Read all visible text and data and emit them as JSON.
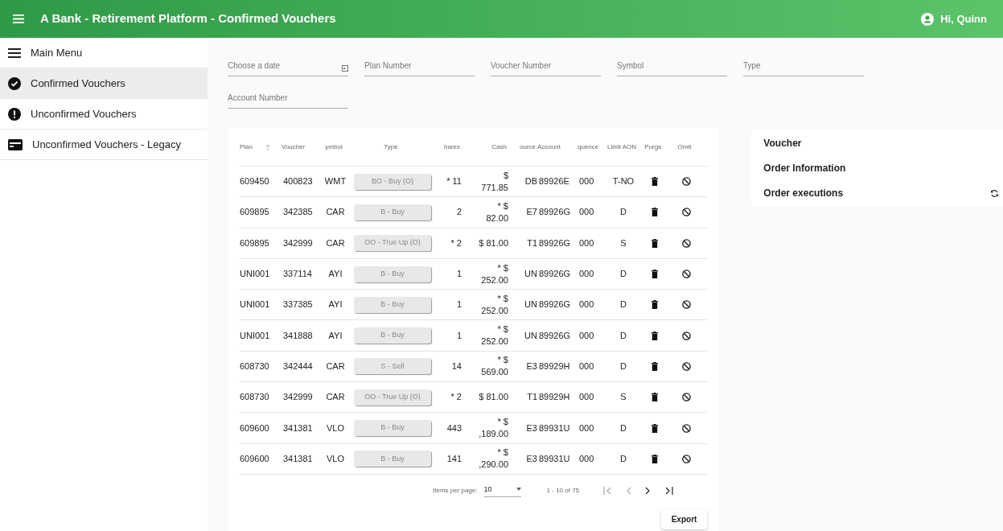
{
  "app_bar": {
    "title": "A Bank - Retirement Platform - Confirmed Vouchers",
    "user": "Hi, Quinn"
  },
  "sidebar": {
    "items": [
      {
        "label": "Main Menu",
        "kind": "menu",
        "selected": false
      },
      {
        "label": "Confirmed Vouchers",
        "kind": "check",
        "selected": true
      },
      {
        "label": "Unconfirmed Vouchers",
        "kind": "alert",
        "selected": false
      },
      {
        "label": "Unconfirmed Vouchers - Legacy",
        "kind": "card",
        "selected": false
      }
    ]
  },
  "filters": [
    {
      "placeholder": "Choose a date",
      "kind": "date"
    },
    {
      "placeholder": "Plan Number",
      "kind": "text"
    },
    {
      "placeholder": "Voucher Number",
      "kind": "text"
    },
    {
      "placeholder": "Symbol",
      "kind": "text"
    },
    {
      "placeholder": "Type",
      "kind": "text"
    },
    {
      "placeholder": "Account Number",
      "kind": "text"
    }
  ],
  "table": {
    "columns": [
      "Plan",
      "Voucher",
      "ymbol",
      "Type",
      "hares",
      "Cash",
      "ource",
      "Account",
      "quence",
      "Limit AON",
      "Purge",
      "Omit"
    ],
    "rows": [
      {
        "plan": "609450",
        "voucher": "400823",
        "symbol": "WMT",
        "type": "BO - Buy (O)",
        "shares": "* 11",
        "cash": "$\n771.85",
        "source": "DB",
        "account": "89926E",
        "sequence": "000",
        "limit": "T-NO"
      },
      {
        "plan": "609895",
        "voucher": "342385",
        "symbol": "CAR",
        "type": "B - Buy",
        "shares": "2",
        "cash": "* $\n82.00",
        "source": "E7",
        "account": "89926G",
        "sequence": "000",
        "limit": "D"
      },
      {
        "plan": "609895",
        "voucher": "342999",
        "symbol": "CAR",
        "type": "OO - True Up (O)",
        "shares": "* 2",
        "cash": "$ 81.00",
        "source": "T1",
        "account": "89926G",
        "sequence": "000",
        "limit": "S"
      },
      {
        "plan": "UNI001",
        "voucher": "337114",
        "symbol": "AYI",
        "type": "B - Buy",
        "shares": "1",
        "cash": "* $\n252.00",
        "source": "UN",
        "account": "89926G",
        "sequence": "000",
        "limit": "D"
      },
      {
        "plan": "UNI001",
        "voucher": "337385",
        "symbol": "AYI",
        "type": "B - Buy",
        "shares": "1",
        "cash": "* $\n252.00",
        "source": "UN",
        "account": "89926G",
        "sequence": "000",
        "limit": "D"
      },
      {
        "plan": "UNI001",
        "voucher": "341888",
        "symbol": "AYI",
        "type": "B - Buy",
        "shares": "1",
        "cash": "* $\n252.00",
        "source": "UN",
        "account": "89926G",
        "sequence": "000",
        "limit": "D"
      },
      {
        "plan": "608730",
        "voucher": "342444",
        "symbol": "CAR",
        "type": "S - Sell",
        "shares": "14",
        "cash": "* $\n569.00",
        "source": "E3",
        "account": "89929H",
        "sequence": "000",
        "limit": "D"
      },
      {
        "plan": "608730",
        "voucher": "342999",
        "symbol": "CAR",
        "type": "OO - True Up (O)",
        "shares": "* 2",
        "cash": "$ 81.00",
        "source": "T1",
        "account": "89929H",
        "sequence": "000",
        "limit": "S"
      },
      {
        "plan": "609600",
        "voucher": "341381",
        "symbol": "VLO",
        "type": "B - Buy",
        "shares": "443",
        "cash": "* $\n,189.00",
        "source": "E3",
        "account": "89931U",
        "sequence": "000",
        "limit": "D"
      },
      {
        "plan": "609600",
        "voucher": "341381",
        "symbol": "VLO",
        "type": "B - Buy",
        "shares": "141",
        "cash": "* $\n,290.00",
        "source": "E3",
        "account": "89931U",
        "sequence": "000",
        "limit": "D"
      }
    ]
  },
  "paginator": {
    "label": "Items per page:",
    "page_size": "10",
    "range": "1 - 10 of 75"
  },
  "export_button": "Export",
  "detail_panel": {
    "sections": [
      "Voucher",
      "Order Information",
      "Order executions"
    ]
  }
}
